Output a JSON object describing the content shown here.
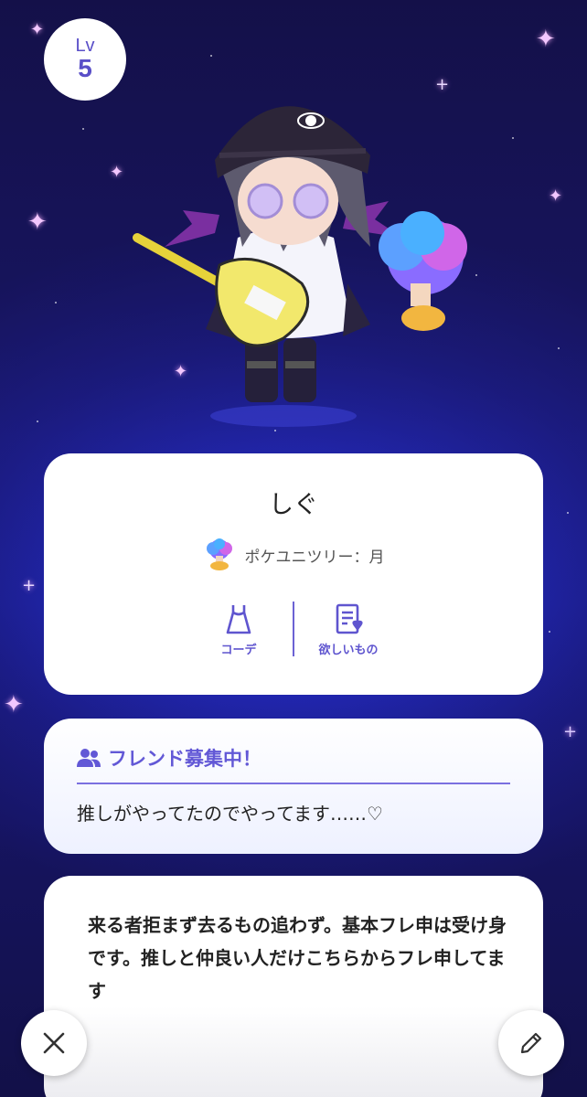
{
  "level": {
    "prefix": "Lv",
    "value": "5"
  },
  "profile": {
    "name": "しぐ",
    "tree_label": "ポケユニツリー：月",
    "actions": [
      {
        "label": "コーデ",
        "icon": "dress-icon"
      },
      {
        "label": "欲しいもの",
        "icon": "wishlist-icon"
      }
    ]
  },
  "friend": {
    "header": "フレンド募集中！",
    "message": "推しがやってたのでやってます……♡"
  },
  "bio": {
    "text": "来る者拒まず去るもの追わず。基本フレ申は受け身です。推しと仲良い人だけこちらからフレ申してます"
  },
  "buttons": {
    "close_icon": "close-icon",
    "edit_icon": "pencil-icon"
  },
  "colors": {
    "accent": "#5f55cf",
    "background": "#1d1f9a",
    "card": "#ffffff"
  }
}
